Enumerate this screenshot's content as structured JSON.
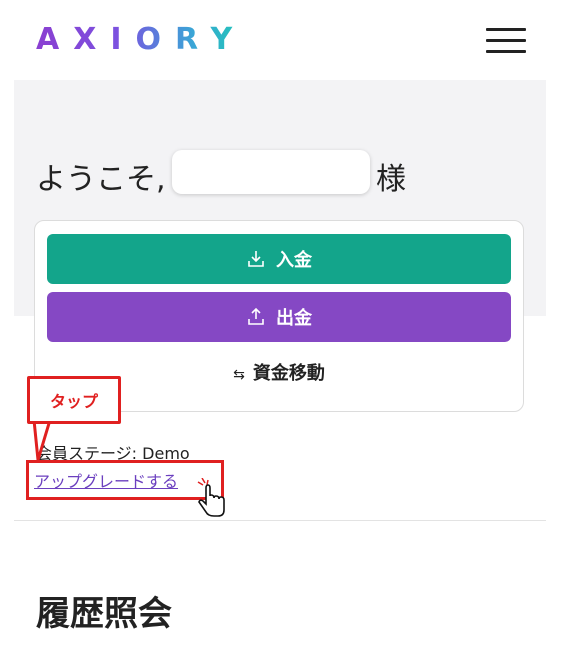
{
  "header": {
    "logo": "AXIORY",
    "menu_icon": "hamburger-menu-icon"
  },
  "welcome": {
    "greeting": "ようこそ,",
    "name_value": "",
    "suffix": "様"
  },
  "actions": {
    "deposit_label": "入金",
    "withdraw_label": "出金",
    "transfer_label": "資金移動",
    "deposit_color": "#13a58b",
    "withdraw_color": "#8548c4"
  },
  "membership": {
    "stage_text": "会員ステージ: Demo",
    "upgrade_link": "アップグレードする"
  },
  "annotation": {
    "callout_text": "タップ",
    "highlight_color": "#e02020"
  },
  "history": {
    "title": "履歴照会"
  }
}
